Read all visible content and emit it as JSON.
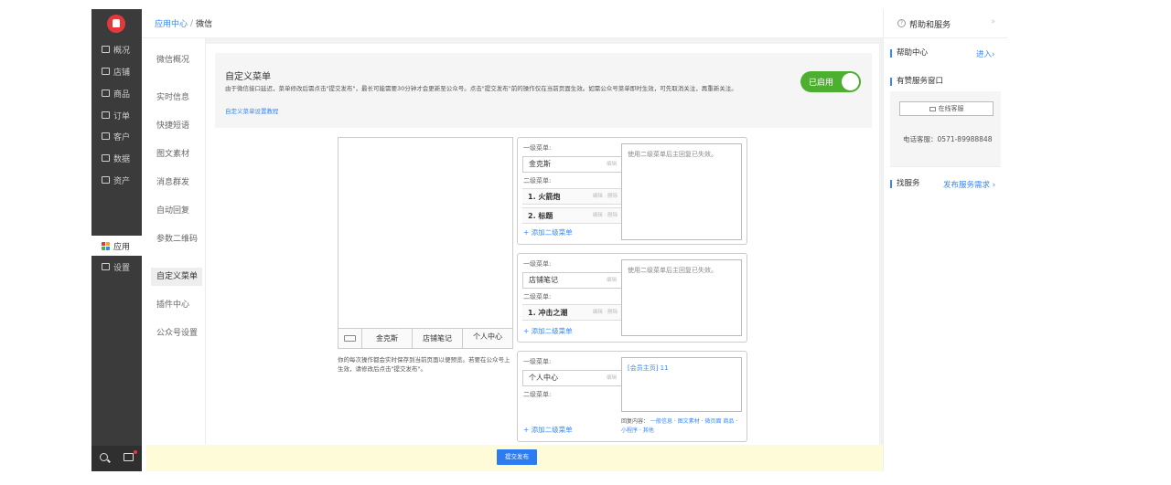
{
  "leftnav": {
    "items": [
      {
        "label": "概况",
        "icon": "monitor-icon"
      },
      {
        "label": "店铺",
        "icon": "store-icon"
      },
      {
        "label": "商品",
        "icon": "tag-icon"
      },
      {
        "label": "订单",
        "icon": "order-icon"
      },
      {
        "label": "客户",
        "icon": "user-icon"
      },
      {
        "label": "数据",
        "icon": "chart-icon"
      },
      {
        "label": "资产",
        "icon": "asset-icon"
      },
      {
        "label": "应用",
        "icon": "apps-icon"
      },
      {
        "label": "设置",
        "icon": "gear-icon"
      }
    ],
    "active": "应用"
  },
  "breadcrumb": {
    "parent": "应用中心",
    "separator": "/",
    "current": "微信"
  },
  "subnav": {
    "items": [
      "微信概况",
      "实时信息",
      "快捷短语",
      "图文素材",
      "消息群发",
      "自动回复",
      "参数二维码",
      "自定义菜单",
      "插件中心",
      "公众号设置"
    ],
    "active": "自定义菜单"
  },
  "intro": {
    "title": "自定义菜单",
    "description": "由于微信接口延迟，菜单修改后需点击\"提交发布\"，最长可能需要30分钟才会更新至公众号。点击\"提交发布\"前的操作仅在当前页面生效。如需公众号菜单即时生效，可先取消关注，再重新关注。",
    "tutorial_link": "自定义菜单设置教程",
    "toggle_label": "已启用"
  },
  "phone": {
    "tabs": [
      "金克斯",
      "店铺笔记",
      "个人中心"
    ],
    "note": "你的每次操作都会实时保存到当前页面以便预览。若要在公众号上生效，请修改后点击\"提交发布\"。"
  },
  "labels": {
    "level1": "一级菜单:",
    "level2": "二级菜单:",
    "edit": "编辑",
    "edit_delete": "编辑 · 删除",
    "add_sub": "+ 添加二级菜单",
    "reply_disabled": "使用二级菜单后主回复已失效。"
  },
  "menus": [
    {
      "name": "金克斯",
      "subs": [
        "1. 火箭炮",
        "2. 标题"
      ]
    },
    {
      "name": "店铺笔记",
      "subs": [
        "1. 冲击之潮"
      ]
    },
    {
      "name": "个人中心",
      "subs": [],
      "reply": "[会员主页] 11"
    }
  ],
  "reply_footer": {
    "label": "回复内容：",
    "options": [
      "一般信息",
      "图文素材",
      "微页面",
      "商品",
      "小程序",
      "其他"
    ]
  },
  "submit": {
    "label": "提交发布"
  },
  "right_panel": {
    "title": "帮助和服务",
    "help_center": "帮助中心",
    "enter": "进入",
    "service_window": "有赞服务窗口",
    "online_service": "在线客服",
    "phone": "电话客服：0571-89988848",
    "find_service": "找服务",
    "publish_need": "发布服务需求"
  },
  "colors": {
    "accent": "#3388ff",
    "toggle_on": "#4caf2f",
    "nav_bg": "#3b3b3b",
    "submit_bar": "#fdfbd8",
    "submit_btn": "#2d7bf0"
  }
}
